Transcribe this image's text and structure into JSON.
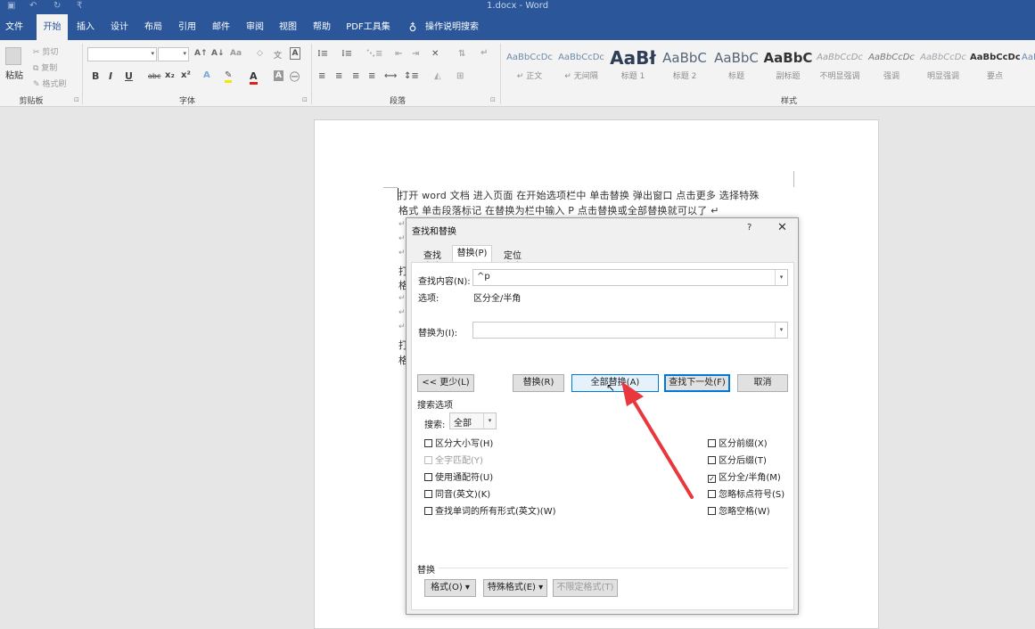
{
  "title_bar": {
    "doc_title": "1.docx - Word",
    "customize": "₹"
  },
  "tabs": [
    "文件",
    "开始",
    "插入",
    "设计",
    "布局",
    "引用",
    "邮件",
    "审阅",
    "视图",
    "帮助",
    "PDF工具集",
    "操作说明搜索"
  ],
  "active_tab": "开始",
  "ribbon": {
    "clipboard": {
      "paste": "粘贴",
      "cut": "剪切",
      "copy": "复制",
      "format_painter": "格式刷",
      "group": "剪贴板"
    },
    "font": {
      "group": "字体"
    },
    "paragraph": {
      "group": "段落"
    },
    "styles": {
      "group": "样式",
      "items": [
        {
          "sample": "AaBbCcDc",
          "name": "↵ 正文"
        },
        {
          "sample": "AaBbCcDc",
          "name": "↵ 无间隔"
        },
        {
          "sample": "AaBł",
          "name": "标题 1"
        },
        {
          "sample": "AaBbC",
          "name": "标题 2"
        },
        {
          "sample": "AaBbC",
          "name": "标题"
        },
        {
          "sample": "AaBbC",
          "name": "副标题"
        },
        {
          "sample": "AaBbCcDc",
          "name": "不明显强调"
        },
        {
          "sample": "AaBbCcDc",
          "name": "强调"
        },
        {
          "sample": "AaBbCcDc",
          "name": "明显强调"
        },
        {
          "sample": "AaBbCcDc",
          "name": "要点"
        },
        {
          "sample": "AaBbC",
          "name": ""
        }
      ]
    }
  },
  "document": {
    "line1": "打开 word 文档   进入页面   在开始选项栏中   单击替换   弹出窗口   点击更多   选择特殊",
    "line2": "格式   单击段落标记   在替换为栏中输入 P   点击替换或全部替换就可以了   ↵"
  },
  "dialog": {
    "title": "查找和替换",
    "help": "?",
    "close": "✕",
    "tabs": [
      "查找(D)",
      "替换(P)",
      "定位(G)"
    ],
    "find_label": "查找内容(N):",
    "find_value": "^p",
    "options_label": "选项:",
    "options_value": "区分全/半角",
    "replace_label": "替换为(I):",
    "replace_value": "",
    "buttons": {
      "less": "<< 更少(L)",
      "replace": "替换(R)",
      "replace_all": "全部替换(A)",
      "find_next": "查找下一处(F)",
      "cancel": "取消"
    },
    "search_options_title": "搜索选项",
    "search_label": "搜索:",
    "search_value": "全部",
    "left_checks": [
      {
        "label": "区分大小写(H)",
        "checked": false,
        "disabled": false
      },
      {
        "label": "全字匹配(Y)",
        "checked": false,
        "disabled": true
      },
      {
        "label": "使用通配符(U)",
        "checked": false,
        "disabled": false
      },
      {
        "label": "同音(英文)(K)",
        "checked": false,
        "disabled": false
      },
      {
        "label": "查找单词的所有形式(英文)(W)",
        "checked": false,
        "disabled": false
      }
    ],
    "right_checks": [
      {
        "label": "区分前缀(X)",
        "checked": false,
        "disabled": false
      },
      {
        "label": "区分后缀(T)",
        "checked": false,
        "disabled": false
      },
      {
        "label": "区分全/半角(M)",
        "checked": true,
        "disabled": false
      },
      {
        "label": "忽略标点符号(S)",
        "checked": false,
        "disabled": false
      },
      {
        "label": "忽略空格(W)",
        "checked": false,
        "disabled": false
      }
    ],
    "replace_section": "替换",
    "format_btn": "格式(O) ▾",
    "special_btn": "特殊格式(E) ▾",
    "no_format_btn": "不限定格式(T)"
  },
  "colors": {
    "accent": "#2b579a",
    "arrow": "#e8383d"
  }
}
